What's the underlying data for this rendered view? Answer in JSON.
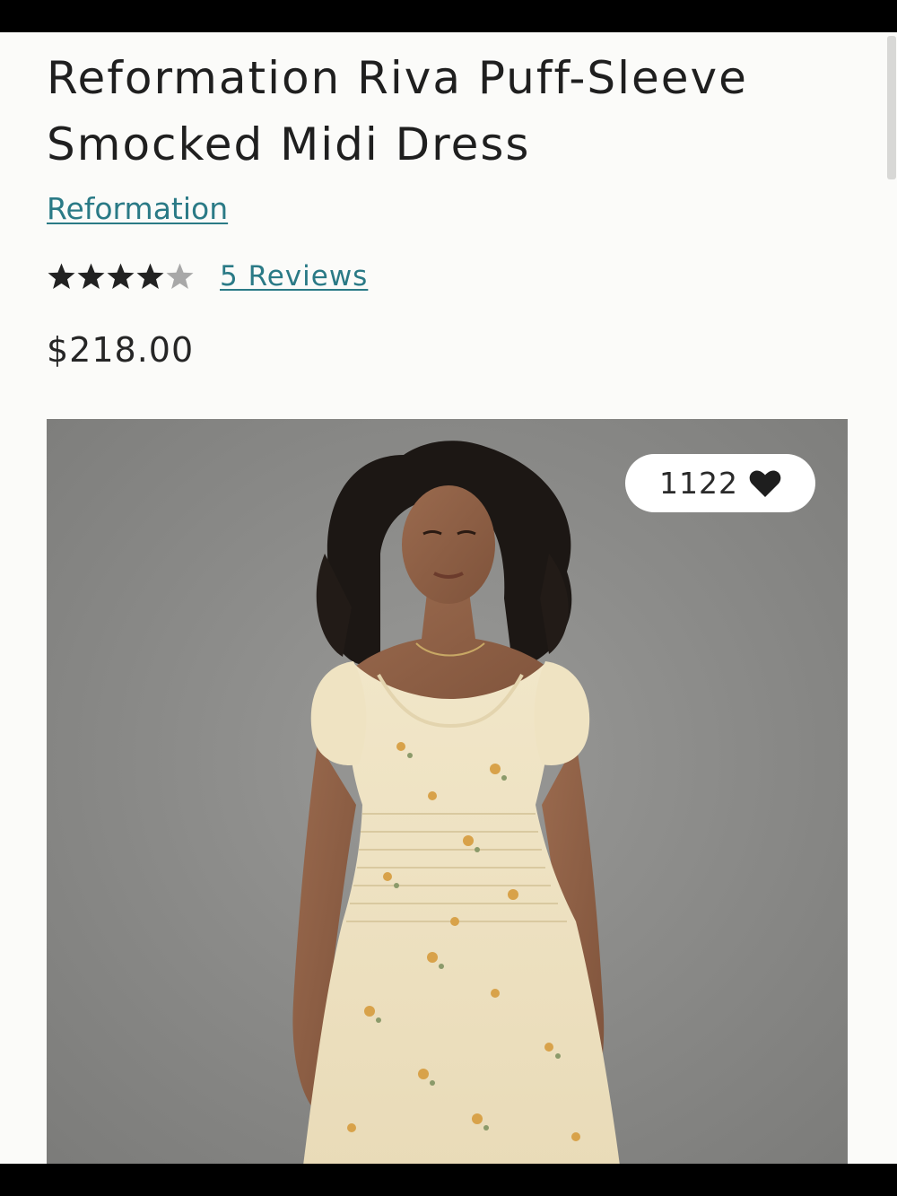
{
  "product": {
    "title": "Reformation Riva Puff-Sleeve Smocked Midi Dress",
    "brand": "Reformation",
    "rating": 4,
    "rating_max": 5,
    "reviews_label": "5 Reviews",
    "price": "$218.00",
    "likes": "1122"
  },
  "icons": {
    "star_filled": "star-icon",
    "star_empty": "star-outline-icon",
    "heart": "heart-icon"
  },
  "colors": {
    "link": "#2a7a86",
    "text": "#1f1f1f",
    "star_filled": "#222222",
    "star_empty": "#a8a8a8",
    "image_background": "#8a8a88"
  }
}
